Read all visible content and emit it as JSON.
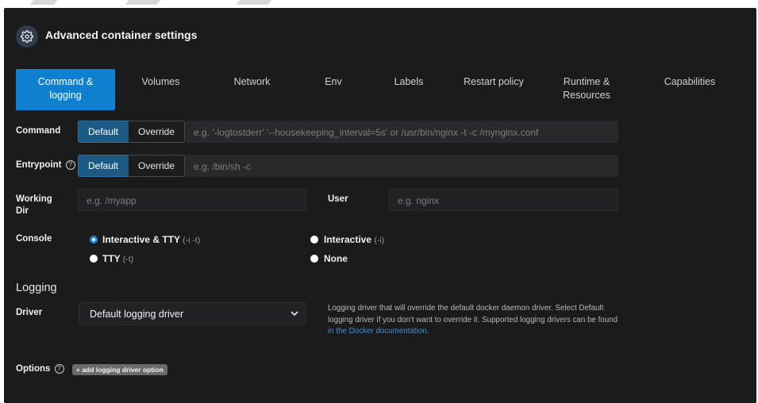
{
  "header": {
    "title": "Advanced container settings",
    "icon": "gear-icon"
  },
  "tabs": [
    {
      "label": "Command &\nlogging",
      "active": true
    },
    {
      "label": "Volumes"
    },
    {
      "label": "Network"
    },
    {
      "label": "Env"
    },
    {
      "label": "Labels"
    },
    {
      "label": "Restart policy"
    },
    {
      "label": "Runtime &\nResources"
    },
    {
      "label": "Capabilities"
    }
  ],
  "command": {
    "label": "Command",
    "default_label": "Default",
    "override_label": "Override",
    "placeholder": "e.g. '-logtostderr' '--housekeeping_interval=5s' or /usr/bin/nginx -t -c /mynginx.conf"
  },
  "entrypoint": {
    "label": "Entrypoint",
    "default_label": "Default",
    "override_label": "Override",
    "placeholder": "e.g. /bin/sh -c"
  },
  "working_dir": {
    "label": "Working\nDir",
    "placeholder": "e.g. /myapp"
  },
  "user": {
    "label": "User",
    "placeholder": "e.g. nginx"
  },
  "console": {
    "label": "Console",
    "options": [
      {
        "label": "Interactive & TTY",
        "sub": "(-i -t)",
        "selected": true
      },
      {
        "label": "Interactive",
        "sub": "(-i)",
        "selected": false
      },
      {
        "label": "TTY",
        "sub": "(-t)",
        "selected": false
      },
      {
        "label": "None",
        "sub": "",
        "selected": false
      }
    ]
  },
  "logging": {
    "section_title": "Logging",
    "driver_label": "Driver",
    "driver_value": "Default logging driver",
    "help_text": "Logging driver that will override the default docker daemon driver. Select Default logging driver if you don't want to override it. Supported logging drivers can be found ",
    "help_link": "in the Docker documentation",
    "help_end": ".",
    "options_label": "Options",
    "add_option_label": "+ add logging driver option"
  },
  "colors": {
    "accent": "#0f7fd0",
    "background": "#1b1b1b",
    "link": "#3b8fe0"
  }
}
